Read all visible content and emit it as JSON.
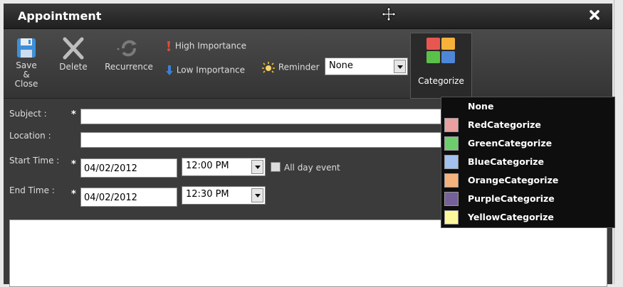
{
  "window": {
    "title": "Appointment"
  },
  "toolbar": {
    "save_label_1": "Save &",
    "save_label_2": "Close",
    "delete_label": "Delete",
    "recurrence_label": "Recurrence",
    "high_importance": "High Importance",
    "low_importance": "Low Importance",
    "reminder_label": "Reminder",
    "reminder_value": "None",
    "categorize_label": "Categorize"
  },
  "form": {
    "subject_label": "Subject :",
    "location_label": "Location :",
    "start_label": "Start Time :",
    "end_label": "End Time :",
    "required_mark": "*",
    "subject_value": "",
    "location_value": "",
    "start_date": "04/02/2012",
    "start_time": "12:00 PM",
    "end_date": "04/02/2012",
    "end_time": "12:30 PM",
    "all_day_label": "All day event"
  },
  "category_menu": {
    "items": [
      {
        "label": "None",
        "color": ""
      },
      {
        "label": "RedCategorize",
        "color": "#e8a0a0"
      },
      {
        "label": "GreenCategorize",
        "color": "#6dcd6d"
      },
      {
        "label": "BlueCategorize",
        "color": "#a3c0ee"
      },
      {
        "label": "OrangeCategorize",
        "color": "#f6b27c"
      },
      {
        "label": "PurpleCategorize",
        "color": "#76609a"
      },
      {
        "label": "YellowCategorize",
        "color": "#fdf79b"
      }
    ]
  },
  "colors": {
    "titlebar": "#262626",
    "panel": "#3b3b3b",
    "dropdown_bg": "#0e0e0e",
    "icon_blue": "#3f8fd6",
    "high_importance_icon": "#e04a3a",
    "low_importance_icon": "#3c7fd9"
  }
}
